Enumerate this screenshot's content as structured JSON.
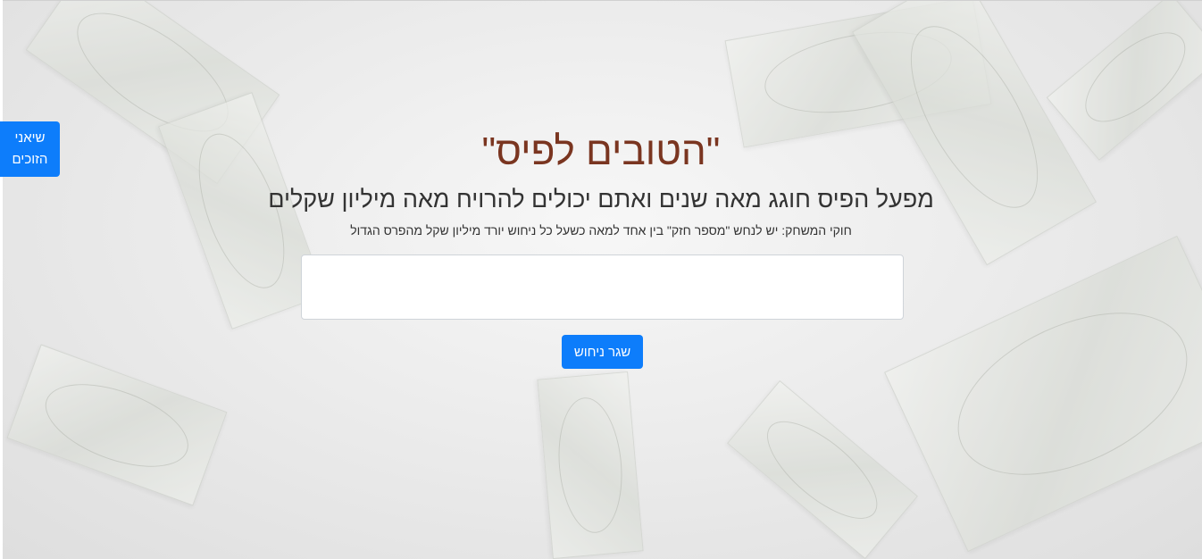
{
  "winners_button": {
    "line1": "שיאני",
    "line2": "הזוכים"
  },
  "header": {
    "title": "\"הטובים לפיס\"",
    "subtitle": "מפעל הפיס חוגג מאה שנים ואתם יכולים להרויח מאה מיליון שקלים",
    "rules": "חוקי המשחק: יש לנחש \"מספר חזק\" בין אחד למאה כשעל כל ניחוש יורד מיליון שקל מהפרס הגדול"
  },
  "guess_form": {
    "input_value": "",
    "submit_label": "שגר ניחוש"
  },
  "colors": {
    "accent": "#0d7dfb",
    "title": "#7a3520",
    "text": "#333333"
  }
}
